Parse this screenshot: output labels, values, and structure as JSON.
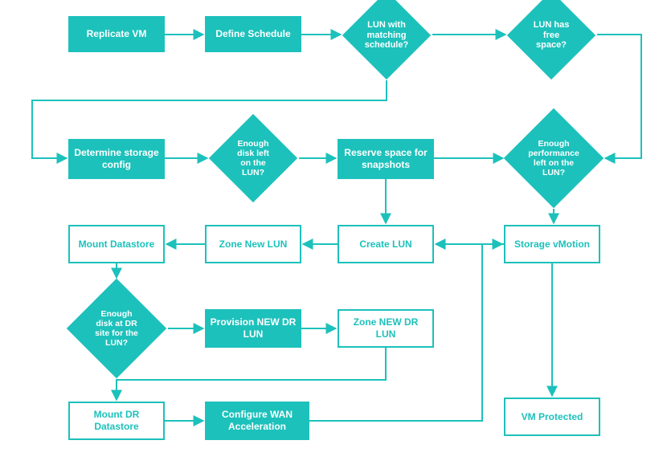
{
  "colors": {
    "accent": "#1dc1bb"
  },
  "node": {
    "replicate_vm": "Replicate VM",
    "define_schedule": "Define Schedule",
    "lun_matching": "LUN with matching schedule?",
    "lun_freespace": "LUN has free space?",
    "determine_storage": "Determine storage config",
    "enough_disk_lun": "Enough disk left on the LUN?",
    "reserve_snapshots": "Reserve space for snapshots",
    "enough_perf_lun": "Enough performance left on the LUN?",
    "mount_datastore": "Mount Datastore",
    "zone_new_lun": "Zone New LUN",
    "create_lun": "Create LUN",
    "storage_vmotion": "Storage vMotion",
    "enough_disk_dr": "Enough disk at DR site for the LUN?",
    "provision_new_dr": "Provision NEW DR LUN",
    "zone_new_dr": "Zone NEW DR LUN",
    "mount_dr_datastore": "Mount DR Datastore",
    "configure_wan": "Configure WAN Acceleration",
    "vm_protected": "VM Protected"
  }
}
